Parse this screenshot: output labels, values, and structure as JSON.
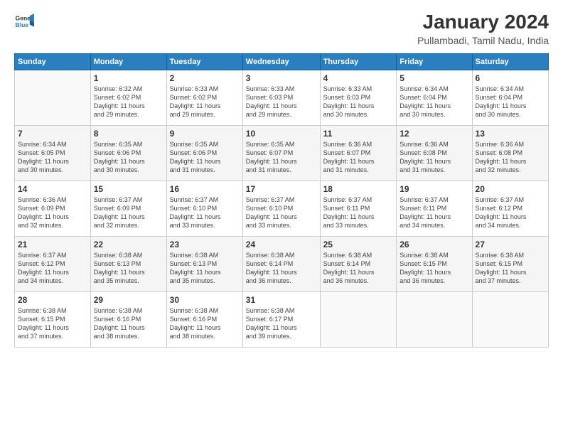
{
  "logo": {
    "line1": "General",
    "line2": "Blue"
  },
  "title": "January 2024",
  "subtitle": "Pullambadi, Tamil Nadu, India",
  "columns": [
    "Sunday",
    "Monday",
    "Tuesday",
    "Wednesday",
    "Thursday",
    "Friday",
    "Saturday"
  ],
  "weeks": [
    [
      {
        "day": "",
        "info": ""
      },
      {
        "day": "1",
        "info": "Sunrise: 6:32 AM\nSunset: 6:02 PM\nDaylight: 11 hours\nand 29 minutes."
      },
      {
        "day": "2",
        "info": "Sunrise: 6:33 AM\nSunset: 6:02 PM\nDaylight: 11 hours\nand 29 minutes."
      },
      {
        "day": "3",
        "info": "Sunrise: 6:33 AM\nSunset: 6:03 PM\nDaylight: 11 hours\nand 29 minutes."
      },
      {
        "day": "4",
        "info": "Sunrise: 6:33 AM\nSunset: 6:03 PM\nDaylight: 11 hours\nand 30 minutes."
      },
      {
        "day": "5",
        "info": "Sunrise: 6:34 AM\nSunset: 6:04 PM\nDaylight: 11 hours\nand 30 minutes."
      },
      {
        "day": "6",
        "info": "Sunrise: 6:34 AM\nSunset: 6:04 PM\nDaylight: 11 hours\nand 30 minutes."
      }
    ],
    [
      {
        "day": "7",
        "info": "Sunrise: 6:34 AM\nSunset: 6:05 PM\nDaylight: 11 hours\nand 30 minutes."
      },
      {
        "day": "8",
        "info": "Sunrise: 6:35 AM\nSunset: 6:06 PM\nDaylight: 11 hours\nand 30 minutes."
      },
      {
        "day": "9",
        "info": "Sunrise: 6:35 AM\nSunset: 6:06 PM\nDaylight: 11 hours\nand 31 minutes."
      },
      {
        "day": "10",
        "info": "Sunrise: 6:35 AM\nSunset: 6:07 PM\nDaylight: 11 hours\nand 31 minutes."
      },
      {
        "day": "11",
        "info": "Sunrise: 6:36 AM\nSunset: 6:07 PM\nDaylight: 11 hours\nand 31 minutes."
      },
      {
        "day": "12",
        "info": "Sunrise: 6:36 AM\nSunset: 6:08 PM\nDaylight: 11 hours\nand 31 minutes."
      },
      {
        "day": "13",
        "info": "Sunrise: 6:36 AM\nSunset: 6:08 PM\nDaylight: 11 hours\nand 32 minutes."
      }
    ],
    [
      {
        "day": "14",
        "info": "Sunrise: 6:36 AM\nSunset: 6:09 PM\nDaylight: 11 hours\nand 32 minutes."
      },
      {
        "day": "15",
        "info": "Sunrise: 6:37 AM\nSunset: 6:09 PM\nDaylight: 11 hours\nand 32 minutes."
      },
      {
        "day": "16",
        "info": "Sunrise: 6:37 AM\nSunset: 6:10 PM\nDaylight: 11 hours\nand 33 minutes."
      },
      {
        "day": "17",
        "info": "Sunrise: 6:37 AM\nSunset: 6:10 PM\nDaylight: 11 hours\nand 33 minutes."
      },
      {
        "day": "18",
        "info": "Sunrise: 6:37 AM\nSunset: 6:11 PM\nDaylight: 11 hours\nand 33 minutes."
      },
      {
        "day": "19",
        "info": "Sunrise: 6:37 AM\nSunset: 6:11 PM\nDaylight: 11 hours\nand 34 minutes."
      },
      {
        "day": "20",
        "info": "Sunrise: 6:37 AM\nSunset: 6:12 PM\nDaylight: 11 hours\nand 34 minutes."
      }
    ],
    [
      {
        "day": "21",
        "info": "Sunrise: 6:37 AM\nSunset: 6:12 PM\nDaylight: 11 hours\nand 34 minutes."
      },
      {
        "day": "22",
        "info": "Sunrise: 6:38 AM\nSunset: 6:13 PM\nDaylight: 11 hours\nand 35 minutes."
      },
      {
        "day": "23",
        "info": "Sunrise: 6:38 AM\nSunset: 6:13 PM\nDaylight: 11 hours\nand 35 minutes."
      },
      {
        "day": "24",
        "info": "Sunrise: 6:38 AM\nSunset: 6:14 PM\nDaylight: 11 hours\nand 36 minutes."
      },
      {
        "day": "25",
        "info": "Sunrise: 6:38 AM\nSunset: 6:14 PM\nDaylight: 11 hours\nand 36 minutes."
      },
      {
        "day": "26",
        "info": "Sunrise: 6:38 AM\nSunset: 6:15 PM\nDaylight: 11 hours\nand 36 minutes."
      },
      {
        "day": "27",
        "info": "Sunrise: 6:38 AM\nSunset: 6:15 PM\nDaylight: 11 hours\nand 37 minutes."
      }
    ],
    [
      {
        "day": "28",
        "info": "Sunrise: 6:38 AM\nSunset: 6:15 PM\nDaylight: 11 hours\nand 37 minutes."
      },
      {
        "day": "29",
        "info": "Sunrise: 6:38 AM\nSunset: 6:16 PM\nDaylight: 11 hours\nand 38 minutes."
      },
      {
        "day": "30",
        "info": "Sunrise: 6:38 AM\nSunset: 6:16 PM\nDaylight: 11 hours\nand 38 minutes."
      },
      {
        "day": "31",
        "info": "Sunrise: 6:38 AM\nSunset: 6:17 PM\nDaylight: 11 hours\nand 39 minutes."
      },
      {
        "day": "",
        "info": ""
      },
      {
        "day": "",
        "info": ""
      },
      {
        "day": "",
        "info": ""
      }
    ]
  ]
}
